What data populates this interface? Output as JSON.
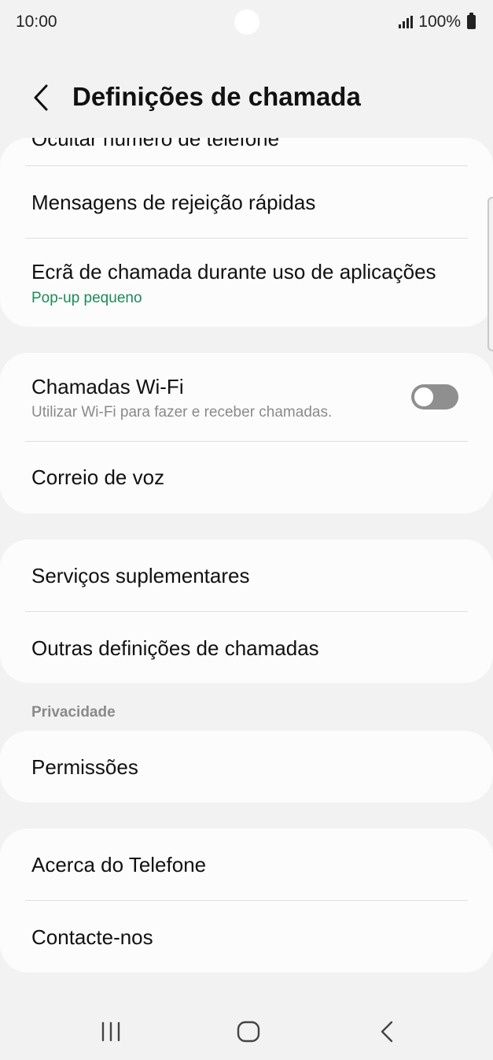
{
  "status_bar": {
    "time": "10:00",
    "battery": "100%"
  },
  "header": {
    "title": "Definições de chamada"
  },
  "card1": {
    "partial_item": "Ocultar número de telefone",
    "items": [
      {
        "title": "Mensagens de rejeição rápidas"
      },
      {
        "title": "Ecrã de chamada durante uso de aplicações",
        "subtitle": "Pop-up pequeno"
      }
    ]
  },
  "card2": {
    "wifi_calling": {
      "title": "Chamadas Wi-Fi",
      "subtitle": "Utilizar Wi-Fi para fazer e receber chamadas.",
      "enabled": false
    },
    "voicemail": {
      "title": "Correio de voz"
    }
  },
  "card3": {
    "items": [
      {
        "title": "Serviços suplementares"
      },
      {
        "title": "Outras definições de chamadas"
      }
    ]
  },
  "privacy": {
    "section_label": "Privacidade",
    "items": [
      {
        "title": "Permissões"
      }
    ]
  },
  "card5": {
    "items": [
      {
        "title": "Acerca do Telefone"
      },
      {
        "title": "Contacte-nos"
      }
    ]
  },
  "colors": {
    "accent_green": "#1e8a5a",
    "background": "#f2f2f2",
    "card": "#fcfcfc"
  },
  "nav_bar": {
    "icons": [
      "recent-apps-icon",
      "home-icon",
      "back-icon"
    ]
  }
}
